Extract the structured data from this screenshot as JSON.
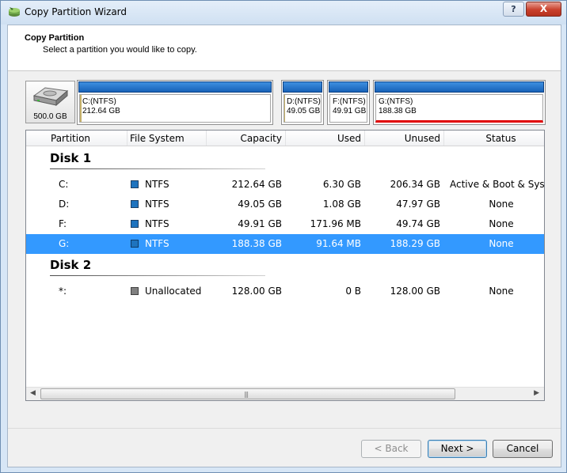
{
  "window": {
    "title": "Copy Partition Wizard",
    "help_label": "?",
    "close_label": "X"
  },
  "header": {
    "title": "Copy Partition",
    "subtitle": "Select a partition you would like to copy."
  },
  "disk_map": {
    "disk_size": "500.0 GB",
    "partitions": [
      {
        "label": "C:(NTFS)",
        "size": "212.64 GB",
        "used_fraction": 0.03
      },
      {
        "label": "D:(NTFS)",
        "size": "49.05 GB",
        "used_fraction": 0.02
      },
      {
        "label": "F:(NTFS)",
        "size": "49.91 GB",
        "used_fraction": 0.0
      },
      {
        "label": "G:(NTFS)",
        "size": "188.38 GB",
        "used_fraction": 0.0,
        "selected": true
      }
    ]
  },
  "table": {
    "columns": [
      "Partition",
      "File System",
      "Capacity",
      "Used",
      "Unused",
      "Status"
    ],
    "groups": [
      {
        "name": "Disk 1",
        "rows": [
          {
            "partition": "C:",
            "fs": "NTFS",
            "capacity": "212.64 GB",
            "used": "6.30 GB",
            "unused": "206.34 GB",
            "status": "Active & Boot & System",
            "color": "#1e73be"
          },
          {
            "partition": "D:",
            "fs": "NTFS",
            "capacity": "49.05 GB",
            "used": "1.08 GB",
            "unused": "47.97 GB",
            "status": "None",
            "color": "#1e73be"
          },
          {
            "partition": "F:",
            "fs": "NTFS",
            "capacity": "49.91 GB",
            "used": "171.96 MB",
            "unused": "49.74 GB",
            "status": "None",
            "color": "#1e73be"
          },
          {
            "partition": "G:",
            "fs": "NTFS",
            "capacity": "188.38 GB",
            "used": "91.64 MB",
            "unused": "188.29 GB",
            "status": "None",
            "color": "#1e73be",
            "selected": true
          }
        ]
      },
      {
        "name": "Disk 2",
        "rows": [
          {
            "partition": "*:",
            "fs": "Unallocated",
            "capacity": "128.00 GB",
            "used": "0 B",
            "unused": "128.00 GB",
            "status": "None",
            "color": "#808080"
          }
        ]
      }
    ]
  },
  "buttons": {
    "back": "< Back",
    "next": "Next >",
    "cancel": "Cancel"
  },
  "colors": {
    "selection": "#3399ff",
    "partition_bar": "#1762b8",
    "selected_partition_marker": "#e00000"
  }
}
